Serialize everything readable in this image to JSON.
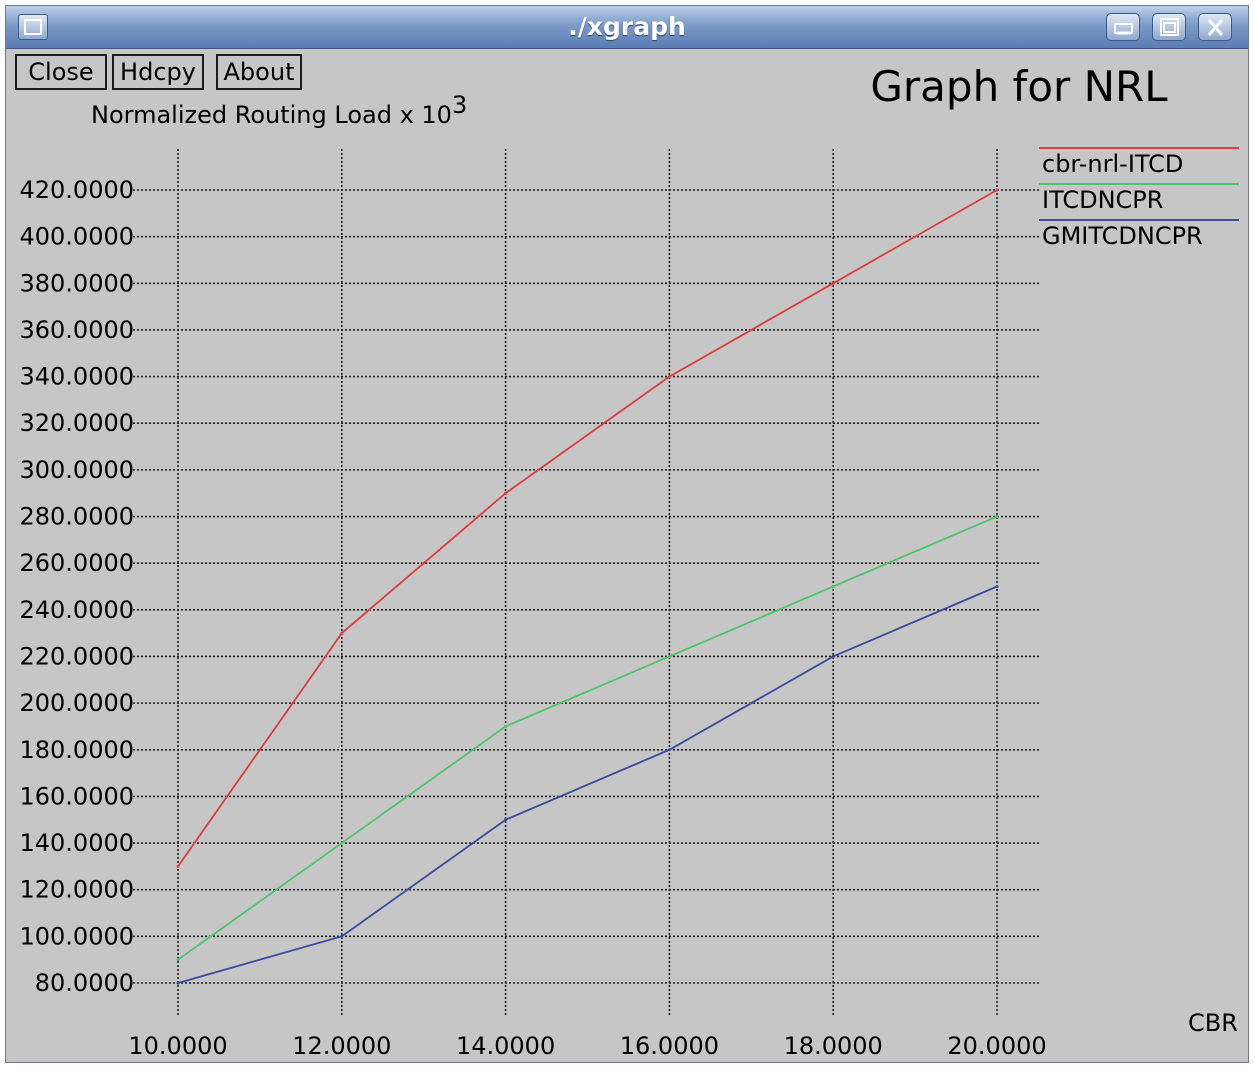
{
  "window": {
    "title": "./xgraph"
  },
  "toolbar": {
    "close_label": "Close",
    "hdcpy_label": "Hdcpy",
    "about_label": "About"
  },
  "icons": {
    "window_menu": "window-menu-icon",
    "minimize": "minimize-icon",
    "maximize": "maximize-icon",
    "close": "close-icon"
  },
  "chart_data": {
    "type": "line",
    "title": "Graph for NRL",
    "ylabel_text": "Normalized Routing Load x 10",
    "ylabel_exponent": "3",
    "xlabel": "CBR",
    "x": [
      10,
      12,
      14,
      16,
      18,
      20
    ],
    "xlim": [
      10,
      20
    ],
    "ylim": [
      80,
      420
    ],
    "x_ticks": [
      "10.0000",
      "12.0000",
      "14.0000",
      "16.0000",
      "18.0000",
      "20.0000"
    ],
    "y_ticks": [
      "80.0000",
      "100.0000",
      "120.0000",
      "140.0000",
      "160.0000",
      "180.0000",
      "200.0000",
      "220.0000",
      "240.0000",
      "260.0000",
      "280.0000",
      "300.0000",
      "320.0000",
      "340.0000",
      "360.0000",
      "380.0000",
      "400.0000",
      "420.0000"
    ],
    "grid": true,
    "legend_position": "right",
    "series": [
      {
        "name": "cbr-nrl-ITCD",
        "color": "#e03c3c",
        "values": [
          130,
          230,
          290,
          340,
          380,
          420
        ]
      },
      {
        "name": "ITCDNCPR",
        "color": "#4cc56a",
        "values": [
          90,
          140,
          190,
          220,
          250,
          280
        ]
      },
      {
        "name": "GMITCDNCPR",
        "color": "#3c4aa0",
        "values": [
          80,
          100,
          150,
          180,
          220,
          250
        ]
      }
    ]
  }
}
